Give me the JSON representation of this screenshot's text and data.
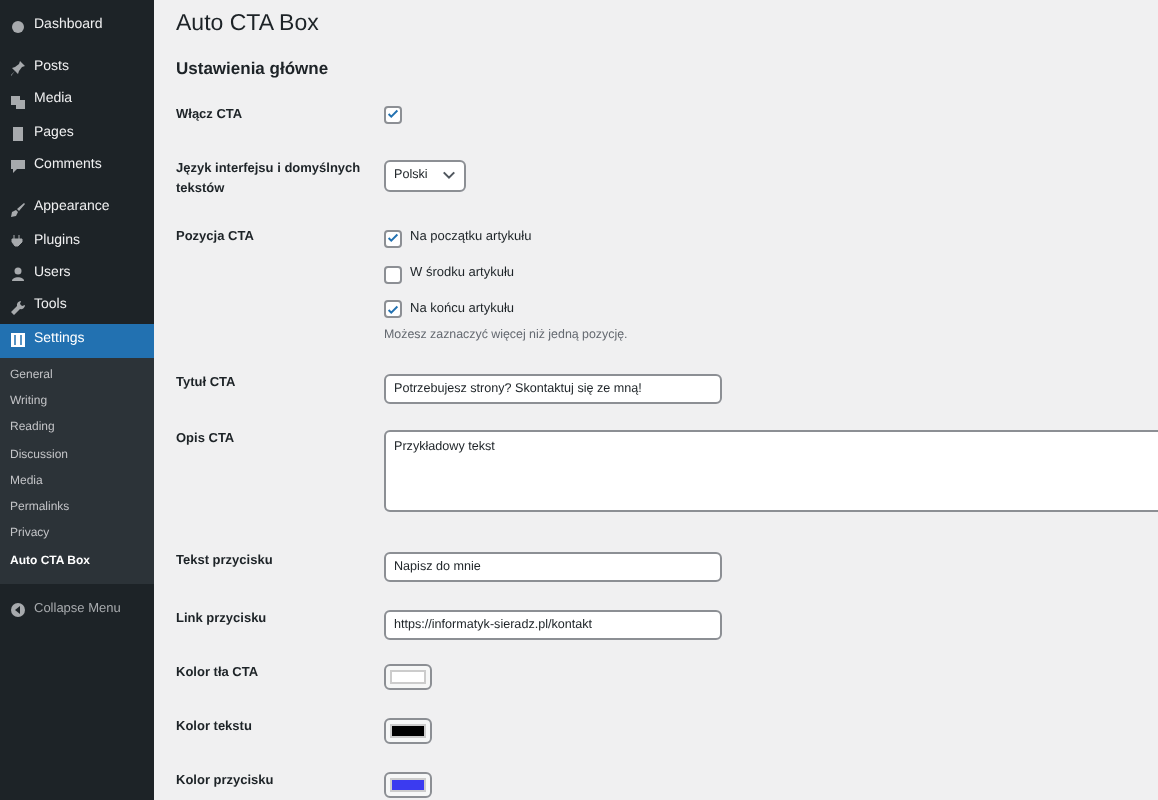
{
  "sidebar": {
    "items": [
      {
        "label": "Dashboard",
        "selected": false
      },
      {
        "label": "Posts",
        "selected": false
      },
      {
        "label": "Media",
        "selected": false
      },
      {
        "label": "Pages",
        "selected": false
      },
      {
        "label": "Comments",
        "selected": false
      },
      {
        "label": "Appearance",
        "selected": false
      },
      {
        "label": "Plugins",
        "selected": false
      },
      {
        "label": "Users",
        "selected": false
      },
      {
        "label": "Tools",
        "selected": false
      },
      {
        "label": "Settings",
        "selected": true,
        "children": [
          {
            "label": "General",
            "selected": false
          },
          {
            "label": "Writing",
            "selected": false
          },
          {
            "label": "Reading",
            "selected": false
          },
          {
            "label": "Discussion",
            "selected": false
          },
          {
            "label": "Media",
            "selected": false
          },
          {
            "label": "Permalinks",
            "selected": false
          },
          {
            "label": "Privacy",
            "selected": false
          },
          {
            "label": "Auto CTA Box",
            "selected": true
          }
        ]
      }
    ],
    "collapse": "Collapse Menu"
  },
  "page": {
    "title": "Auto CTA Box",
    "section": "Ustawienia główne"
  },
  "fields": [
    {
      "kind": "checkbox",
      "label": "Włącz CTA",
      "checked": true
    },
    {
      "kind": "select",
      "label": "Język interfejsu i domyślnych tekstów",
      "value": "Polski"
    },
    {
      "kind": "checkboxes",
      "label": "Pozycja CTA",
      "options": [
        {
          "label": "Na początku artykułu",
          "checked": true
        },
        {
          "label": "W środku artykułu",
          "checked": false
        },
        {
          "label": "Na końcu artykułu",
          "checked": true
        }
      ],
      "hint": "Możesz zaznaczyć więcej niż jedną pozycję."
    },
    {
      "kind": "text",
      "label": "Tytuł CTA",
      "value": "Potrzebujesz strony? Skontaktuj się ze mną!"
    },
    {
      "kind": "textarea",
      "label": "Opis CTA",
      "value": "Przykładowy tekst"
    },
    {
      "kind": "text",
      "label": "Tekst przycisku",
      "value": "Napisz do mnie"
    },
    {
      "kind": "text",
      "label": "Link przycisku",
      "value": "https://informatyk-sieradz.pl/kontakt"
    },
    {
      "kind": "color",
      "label": "Kolor tła CTA",
      "color": "#ffffff"
    },
    {
      "kind": "color",
      "label": "Kolor tekstu",
      "color": "#000000"
    },
    {
      "kind": "color",
      "label": "Kolor przycisku",
      "color": "#3b3bf0"
    }
  ]
}
